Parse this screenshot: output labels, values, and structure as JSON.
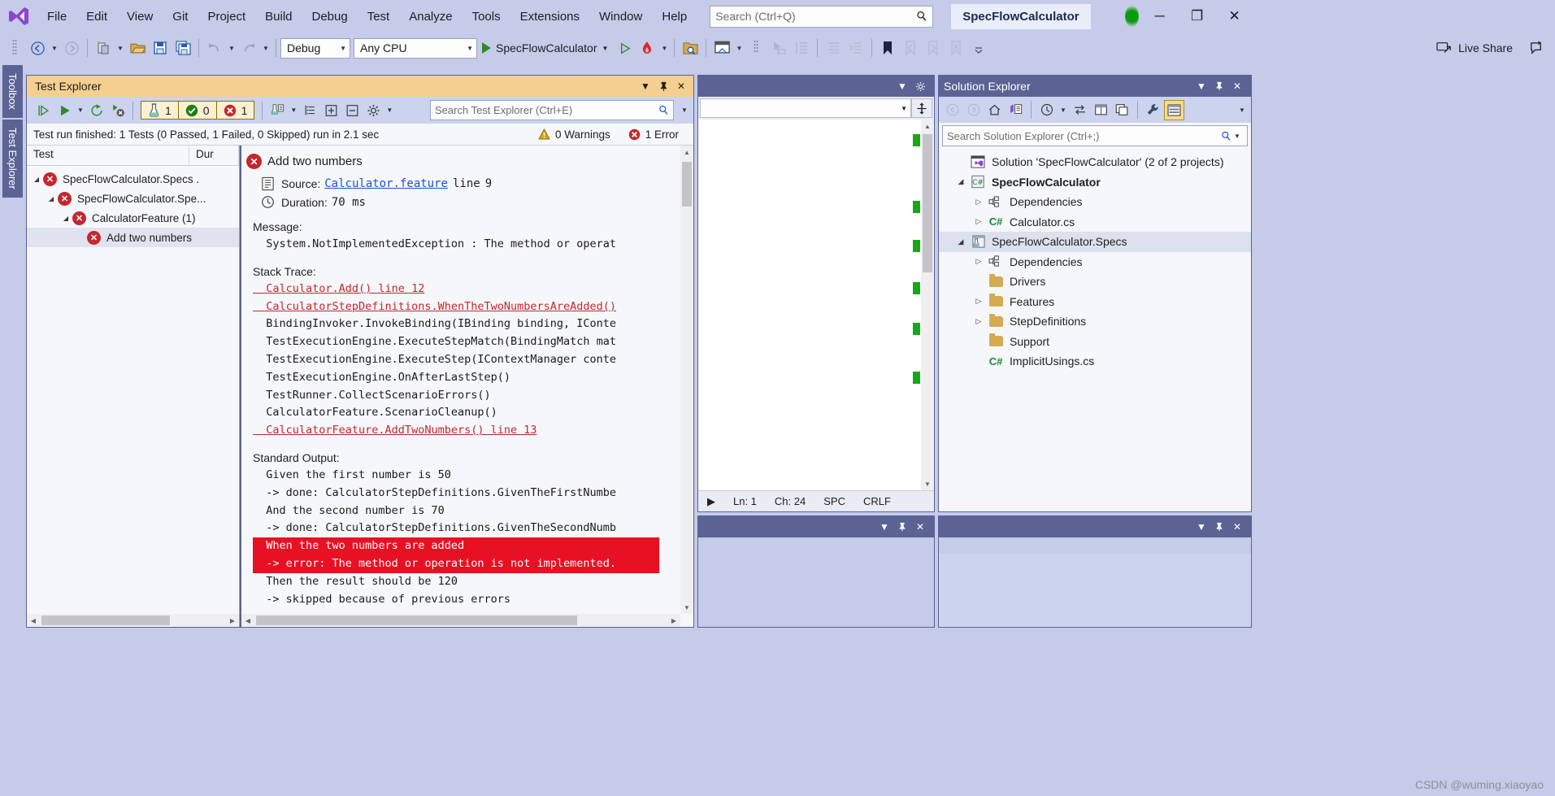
{
  "titlebar": {
    "logo_icon": "visual-studio-logo",
    "menus": [
      "File",
      "Edit",
      "View",
      "Git",
      "Project",
      "Build",
      "Debug",
      "Test",
      "Analyze",
      "Tools",
      "Extensions",
      "Window",
      "Help"
    ],
    "search_placeholder": "Search (Ctrl+Q)",
    "search_icon": "search-icon",
    "solution_name": "SpecFlowCalculator",
    "status_dot": "green-activity-indicator",
    "minimize": "─",
    "maximize": "❐",
    "close": "✕"
  },
  "toolbar": {
    "nav_back_icon": "back-arrow-icon",
    "nav_forward_icon": "forward-arrow-icon",
    "new_project_icon": "new-project-icon",
    "open_file_icon": "open-file-icon",
    "save_icon": "save-icon",
    "save_all_icon": "save-all-icon",
    "undo_icon": "undo-icon",
    "redo_icon": "redo-icon",
    "configuration": "Debug",
    "platform": "Any CPU",
    "start_label": "SpecFlowCalculator",
    "start_icon": "run-icon",
    "hot_reload_icon": "hot-reload-icon",
    "find_in_files_icon": "find-in-files-icon",
    "home_icon": "home-window-icon",
    "select_icon": "pointer-icon",
    "indent_icon": "indent-icon",
    "align_icon": "align-icon",
    "outdent_icon": "outdent-icon",
    "bookmark_icon": "bookmark-icon",
    "prev_bookmark_icon": "previous-bookmark-icon",
    "next_bookmark_icon": "next-bookmark-icon",
    "clear_bookmarks_icon": "clear-bookmarks-icon",
    "live_share": "Live Share",
    "live_share_icon": "live-share-icon",
    "feedback_icon": "feedback-icon"
  },
  "rail": {
    "toolbox": "Toolbox",
    "test_explorer": "Test Explorer"
  },
  "test_explorer": {
    "title": "Test Explorer",
    "dropdown_icon": "chevron-down-icon",
    "pin_icon": "pin-icon",
    "close_icon": "close-icon",
    "toolbar": {
      "run_all_icon": "run-all-tests-icon",
      "run_icon": "run-tests-icon",
      "run_dropdown_icon": "chevron-down-icon",
      "repeat_icon": "repeat-last-run-icon",
      "cancel_icon": "cancel-run-icon",
      "group_icon": "group-by-icon",
      "group_dropdown_icon": "chevron-down-icon",
      "list_icon": "show-test-hierarchy-icon",
      "expand_icon": "expand-all-icon",
      "collapse_icon": "collapse-all-icon",
      "settings_icon": "settings-gear-icon",
      "settings_dropdown_icon": "chevron-down-icon"
    },
    "counters": {
      "total_icon": "flask-icon",
      "total": "1",
      "passed_icon": "passed-check-icon",
      "passed": "0",
      "failed_icon": "failed-x-icon",
      "failed": "1"
    },
    "search_placeholder": "Search Test Explorer (Ctrl+E)",
    "search_icon": "search-icon",
    "search_dropdown_icon": "chevron-down-icon",
    "status": "Test run finished: 1 Tests (0 Passed, 1 Failed, 0 Skipped) run in 2.1 sec",
    "warnings_icon": "warning-triangle-icon",
    "warnings": "0 Warnings",
    "errors_icon": "error-x-icon",
    "errors": "1 Error",
    "columns": [
      "Test",
      "Dur"
    ],
    "tree": [
      {
        "label": "SpecFlowCalculator.Specs  .",
        "indent": 0,
        "expanded": true,
        "status": "failed",
        "selected": false
      },
      {
        "label": "SpecFlowCalculator.Spe...",
        "indent": 1,
        "expanded": true,
        "status": "failed",
        "selected": false
      },
      {
        "label": "CalculatorFeature (1)",
        "indent": 2,
        "expanded": true,
        "status": "failed",
        "selected": false
      },
      {
        "label": "Add two numbers",
        "indent": 3,
        "expanded": false,
        "status": "failed",
        "selected": true
      }
    ],
    "detail": {
      "test_name": "Add two numbers",
      "status_icon": "failed-x-icon",
      "source_icon": "source-file-icon",
      "source_label": "Source:",
      "source_link": "Calculator.feature",
      "source_line_label": "line",
      "source_line": "9",
      "duration_icon": "clock-icon",
      "duration_label": "Duration:",
      "duration_value": "70 ms",
      "message_heading": "Message:",
      "message_body": "  System.NotImplementedException : The method or operat",
      "stack_heading": "Stack Trace:",
      "stack_lines": [
        {
          "text": "  Calculator.Add() line 12",
          "link": true
        },
        {
          "text": "  CalculatorStepDefinitions.WhenTheTwoNumbersAreAdded()",
          "link": true
        },
        {
          "text": "  BindingInvoker.InvokeBinding(IBinding binding, IConte",
          "link": false
        },
        {
          "text": "  TestExecutionEngine.ExecuteStepMatch(BindingMatch mat",
          "link": false
        },
        {
          "text": "  TestExecutionEngine.ExecuteStep(IContextManager conte",
          "link": false
        },
        {
          "text": "  TestExecutionEngine.OnAfterLastStep()",
          "link": false
        },
        {
          "text": "  TestRunner.CollectScenarioErrors()",
          "link": false
        },
        {
          "text": "  CalculatorFeature.ScenarioCleanup()",
          "link": false
        },
        {
          "text": "  CalculatorFeature.AddTwoNumbers() line 13",
          "link": true
        }
      ],
      "output_heading": "Standard Output:",
      "output_lines": [
        {
          "text": "  Given the first number is 50",
          "error": false
        },
        {
          "text": "  -> done: CalculatorStepDefinitions.GivenTheFirstNumbe",
          "error": false
        },
        {
          "text": "  And the second number is 70",
          "error": false
        },
        {
          "text": "  -> done: CalculatorStepDefinitions.GivenTheSecondNumb",
          "error": false
        },
        {
          "text": "  When the two numbers are added",
          "error": true
        },
        {
          "text": "  -> error: The method or operation is not implemented.",
          "error": true
        },
        {
          "text": "  Then the result should be 120",
          "error": false
        },
        {
          "text": "  -> skipped because of previous errors",
          "error": false
        }
      ]
    }
  },
  "editor": {
    "dropdown_icon": "chevron-down-icon",
    "settings_icon": "settings-gear-icon",
    "nav_combo_value": "",
    "nav_combo_caret": "chevron-down-icon",
    "splitter_icon": "split-view-icon",
    "status": {
      "expand_icon": "expand-arrow-icon",
      "line": "Ln: 1",
      "column": "Ch: 24",
      "spaces": "SPC",
      "eol": "CRLF"
    }
  },
  "output_panel": {
    "dropdown_icon": "chevron-down-icon",
    "pin_icon": "pin-icon",
    "close_icon": "close-icon"
  },
  "solution_explorer": {
    "title": "Solution Explorer",
    "dropdown_icon": "chevron-down-icon",
    "pin_icon": "pin-icon",
    "close_icon": "close-icon",
    "toolbar": {
      "back_icon": "back-arrow-icon",
      "forward_icon": "forward-arrow-icon",
      "home_icon": "home-icon",
      "pending_changes_icon": "pending-changes-icon",
      "history_icon": "history-clock-icon",
      "history_dropdown_icon": "chevron-down-icon",
      "sync_icon": "sync-with-active-document-icon",
      "properties_icon": "properties-window-icon",
      "preview_icon": "preview-selected-items-icon",
      "show_all_files_icon": "show-all-files-icon",
      "collapse_icon": "collapse-all-icon",
      "wrench_icon": "wrench-icon",
      "view_icon": "view-designer-icon"
    },
    "search_placeholder": "Search Solution Explorer (Ctrl+;)",
    "search_icon": "search-icon",
    "search_dropdown_icon": "chevron-down-icon",
    "tree": [
      {
        "label": "Solution 'SpecFlowCalculator' (2 of 2 projects)",
        "indent": 0,
        "icon": "solution-icon",
        "expander": "none",
        "bold": false,
        "selected": false
      },
      {
        "label": "SpecFlowCalculator",
        "indent": 1,
        "icon": "csharp-project-icon",
        "expander": "expanded",
        "bold": true,
        "selected": false
      },
      {
        "label": "Dependencies",
        "indent": 2,
        "icon": "dependencies-icon",
        "expander": "collapsed",
        "bold": false,
        "selected": false
      },
      {
        "label": "Calculator.cs",
        "indent": 2,
        "icon": "csharp-file-icon",
        "expander": "collapsed",
        "bold": false,
        "selected": false
      },
      {
        "label": "SpecFlowCalculator.Specs",
        "indent": 1,
        "icon": "specflow-project-icon",
        "expander": "expanded",
        "bold": false,
        "selected": true
      },
      {
        "label": "Dependencies",
        "indent": 2,
        "icon": "dependencies-icon",
        "expander": "collapsed",
        "bold": false,
        "selected": false
      },
      {
        "label": "Drivers",
        "indent": 2,
        "icon": "folder-icon",
        "expander": "none",
        "bold": false,
        "selected": false
      },
      {
        "label": "Features",
        "indent": 2,
        "icon": "folder-icon",
        "expander": "collapsed",
        "bold": false,
        "selected": false
      },
      {
        "label": "StepDefinitions",
        "indent": 2,
        "icon": "folder-icon",
        "expander": "collapsed",
        "bold": false,
        "selected": false
      },
      {
        "label": "Support",
        "indent": 2,
        "icon": "folder-icon",
        "expander": "none",
        "bold": false,
        "selected": false
      },
      {
        "label": "ImplicitUsings.cs",
        "indent": 2,
        "icon": "csharp-file-icon",
        "expander": "none",
        "bold": false,
        "selected": false
      }
    ]
  },
  "properties_panel": {
    "dropdown_icon": "chevron-down-icon",
    "pin_icon": "pin-icon",
    "close_icon": "close-icon"
  },
  "watermark": "CSDN @wuming.xiaoyao",
  "colors": {
    "chrome": "#c5cbe8",
    "panel_title": "#5a6394",
    "testexp_title": "#f5cf8f",
    "fail_red": "#c5272d",
    "pass_green": "#1a8a1a",
    "error_highlight": "#e81123",
    "link_blue": "#1f4fd8"
  }
}
